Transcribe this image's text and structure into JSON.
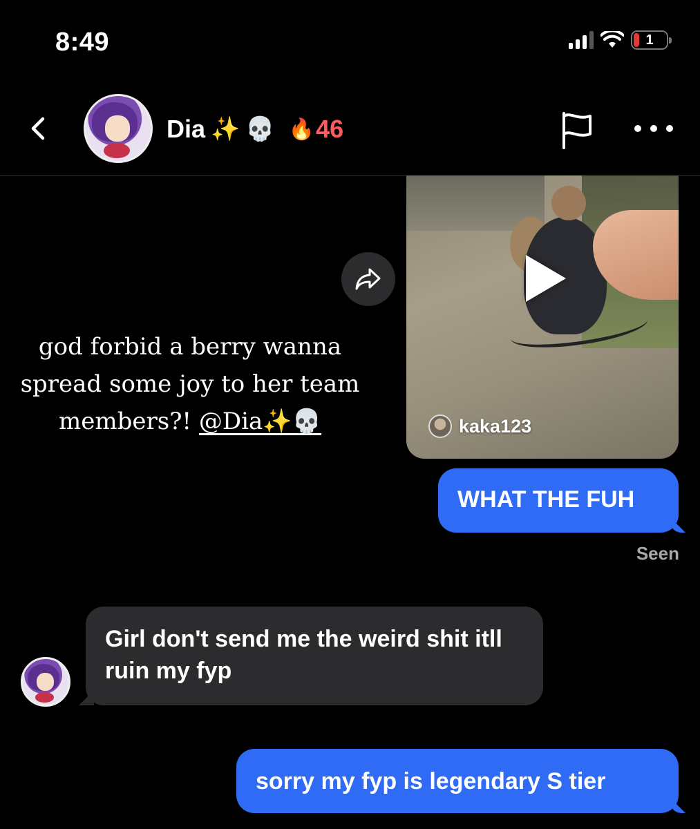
{
  "status_bar": {
    "time": "8:49",
    "battery_level": "1",
    "signal_icon": "cellular-signal-icon",
    "wifi_icon": "wifi-icon"
  },
  "header": {
    "back_icon": "chevron-left-icon",
    "contact_name": "Dia",
    "name_emoji_1": "✨",
    "name_emoji_2": "💀",
    "streak_icon": "🔥",
    "streak_count": "46",
    "flag_icon": "flag-icon",
    "more_icon": "more-horizontal-icon"
  },
  "shared_post": {
    "caption_text": "god forbid a berry wanna spread some joy to her team members?! ",
    "caption_mention": "@Dia✨💀",
    "author": "kaka123",
    "share_icon": "share-arrow-icon",
    "play_icon": "play-icon"
  },
  "messages": [
    {
      "direction": "outgoing",
      "text": "WHAT THE FUH"
    },
    {
      "direction": "incoming",
      "text": "Girl don't send me the weird shit itll ruin my fyp"
    },
    {
      "direction": "outgoing",
      "text": "sorry my fyp is legendary S tier"
    }
  ],
  "read_receipt": "Seen",
  "colors": {
    "background": "#000000",
    "outgoing_bubble": "#2f6bf5",
    "incoming_bubble": "#2c2c2e",
    "streak": "#ff5a5f",
    "seen_text": "#a8a8a8"
  }
}
